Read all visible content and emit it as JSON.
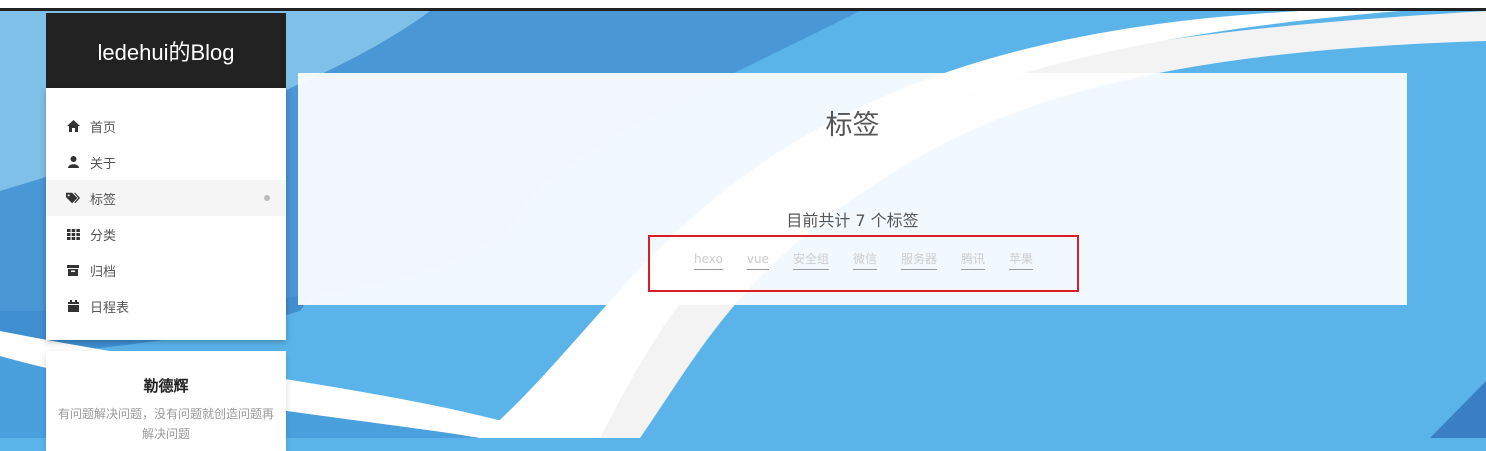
{
  "brand": {
    "title": "ledehui的Blog"
  },
  "menu": {
    "items": [
      {
        "label": "首页",
        "icon": "home-icon"
      },
      {
        "label": "关于",
        "icon": "user-icon"
      },
      {
        "label": "标签",
        "icon": "tags-icon",
        "active": true
      },
      {
        "label": "分类",
        "icon": "grid-icon"
      },
      {
        "label": "归档",
        "icon": "archive-icon"
      },
      {
        "label": "日程表",
        "icon": "calendar-icon"
      }
    ]
  },
  "author": {
    "name": "勒德辉",
    "description": "有问题解决问题，没有问题就创造问题再解决问题"
  },
  "main": {
    "title": "标签",
    "summary": "目前共计 7 个标签",
    "tags": [
      "hexo",
      "vue",
      "安全组",
      "微信",
      "服务器",
      "腾讯",
      "苹果"
    ]
  },
  "colors": {
    "background": "#5ab4ea",
    "sidebar_header": "#222222",
    "highlight_box": "#d81e28"
  }
}
